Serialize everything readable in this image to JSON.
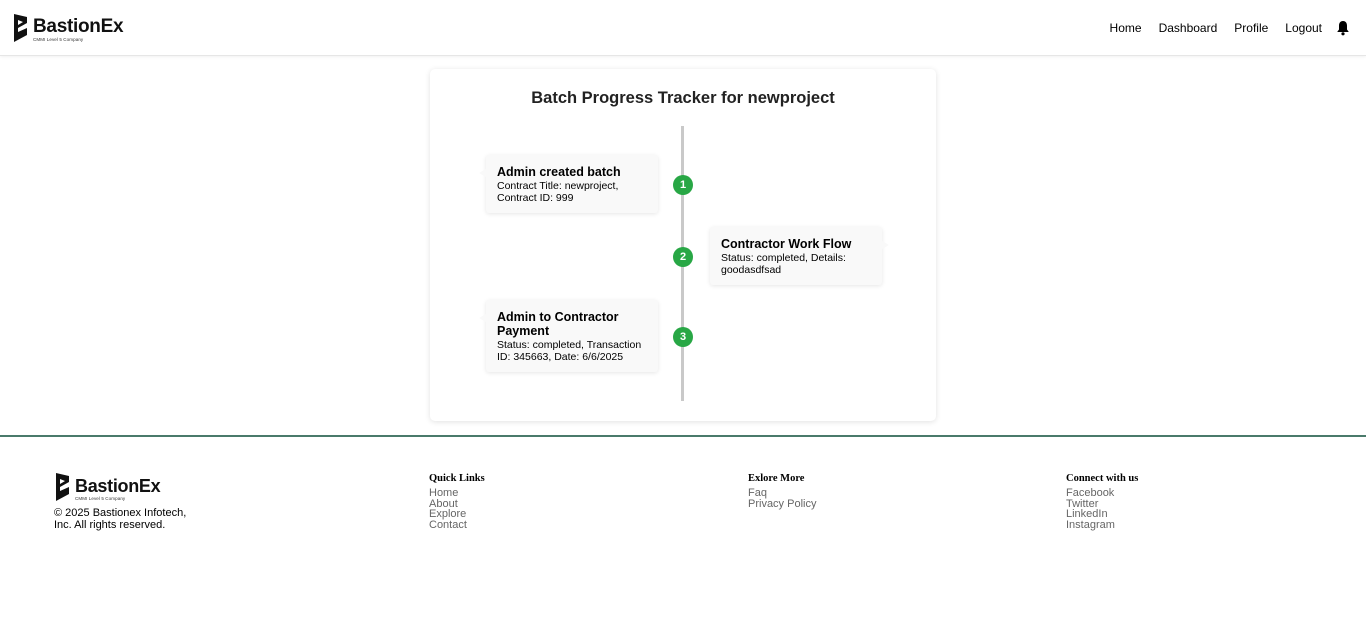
{
  "brand": {
    "name": "BastionEx",
    "tagline": "CMMI Level 5 Company"
  },
  "nav": {
    "items": [
      "Home",
      "Dashboard",
      "Profile",
      "Logout"
    ],
    "bell_icon": "bell-icon"
  },
  "tracker": {
    "title": "Batch Progress Tracker for newproject",
    "events": [
      {
        "step": "1",
        "title": "Admin created batch",
        "description": "Contract Title: newproject, Contract ID: 999",
        "side": "left"
      },
      {
        "step": "2",
        "title": "Contractor Work Flow",
        "description": "Status: completed, Details: goodasdfsad",
        "side": "right"
      },
      {
        "step": "3",
        "title": "Admin to Contractor Payment",
        "description": "Status: completed, Transaction ID: 345663, Date: 6/6/2025",
        "side": "left"
      }
    ],
    "step_color": "#28a745"
  },
  "footer": {
    "copyright": "© 2025 Bastionex Infotech, Inc. All rights reserved.",
    "quick_links": {
      "heading": "Quick Links",
      "items": [
        "Home",
        "About",
        "Explore",
        "Contact"
      ]
    },
    "explore_more": {
      "heading": "Exlore More",
      "items": [
        "Faq",
        "Privacy Policy"
      ]
    },
    "connect": {
      "heading": "Connect with us",
      "items": [
        "Facebook",
        "Twitter",
        "LinkedIn",
        "Instagram"
      ]
    },
    "accent_color": "#4a7a6b"
  }
}
